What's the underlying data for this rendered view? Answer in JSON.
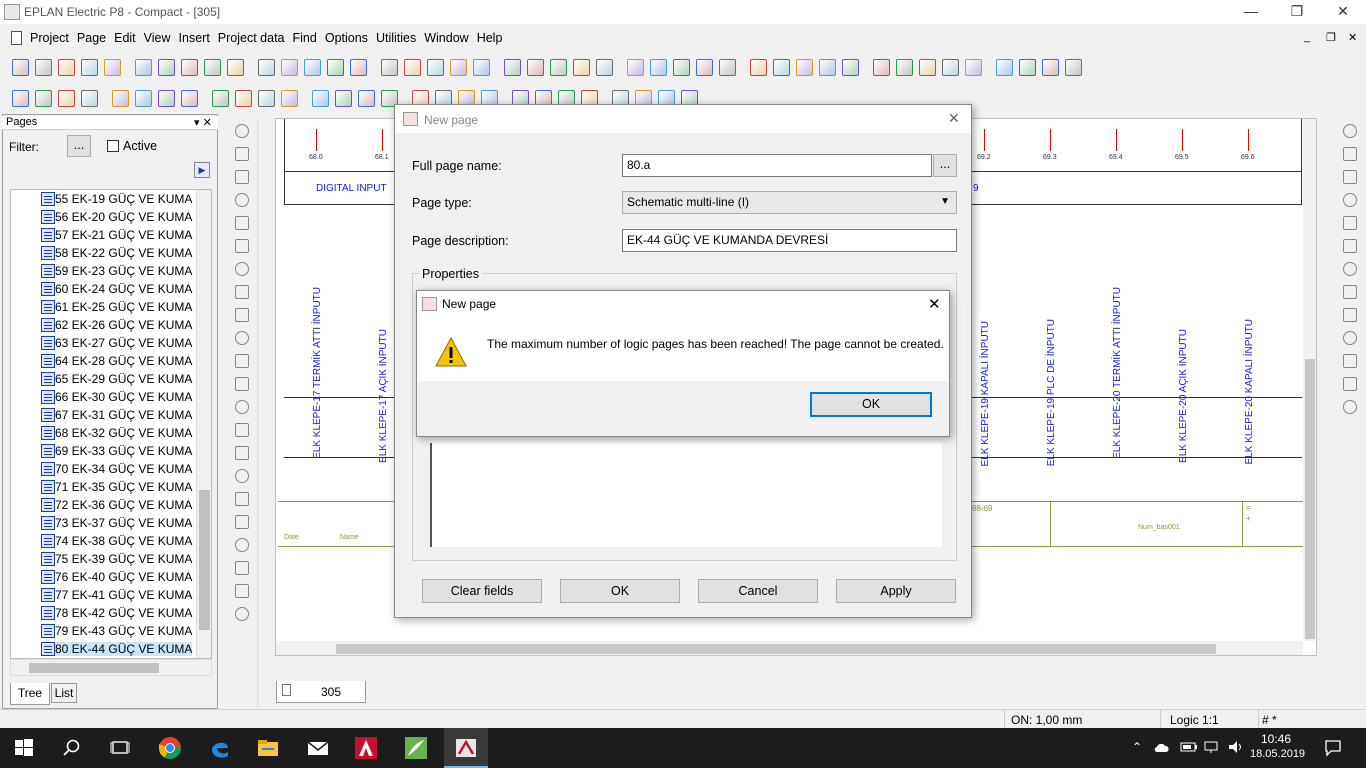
{
  "window": {
    "title": "EPLAN Electric P8 - Compact - [305]",
    "btn_minimize": "—",
    "btn_restore": "❐",
    "btn_close": "✕"
  },
  "menu": [
    "Project",
    "Page",
    "Edit",
    "View",
    "Insert",
    "Project data",
    "Find",
    "Options",
    "Utilities",
    "Window",
    "Help"
  ],
  "mdi_controls": {
    "minimize": "_",
    "restore": "❐",
    "close": "✕"
  },
  "pages_panel": {
    "title": "Pages",
    "pin": "▾ ✕",
    "filter_label": "Filter:",
    "filter_button": "...",
    "active_label": "Active",
    "items": [
      "55 EK-19 GÜÇ VE KUMA",
      "56 EK-20 GÜÇ VE KUMA",
      "57 EK-21 GÜÇ VE KUMA",
      "58 EK-22 GÜÇ VE KUMA",
      "59 EK-23 GÜÇ VE KUMA",
      "60 EK-24 GÜÇ VE KUMA",
      "61 EK-25 GÜÇ VE KUMA",
      "62 EK-26 GÜÇ VE KUMA",
      "63 EK-27 GÜÇ VE KUMA",
      "64 EK-28 GÜÇ VE KUMA",
      "65 EK-29 GÜÇ VE KUMA",
      "66 EK-30 GÜÇ VE KUMA",
      "67 EK-31 GÜÇ VE KUMA",
      "68 EK-32 GÜÇ VE KUMA",
      "69 EK-33 GÜÇ VE KUMA",
      "70 EK-34 GÜÇ VE KUMA",
      "71 EK-35 GÜÇ VE KUMA",
      "72 EK-36 GÜÇ VE KUMA",
      "73 EK-37 GÜÇ VE KUMA",
      "74 EK-38 GÜÇ VE KUMA",
      "75 EK-39 GÜÇ VE KUMA",
      "76 EK-40 GÜÇ VE KUMA",
      "77 EK-41 GÜÇ VE KUMA",
      "78 EK-42 GÜÇ VE KUMA",
      "79 EK-43 GÜÇ VE KUMA",
      "80 EK-44 GÜÇ VE KUMA"
    ],
    "tab_tree": "Tree",
    "tab_list": "List"
  },
  "drawing": {
    "pin_labels": [
      "68.0",
      "68.1",
      "69.2",
      "69.3",
      "69.4",
      "69.5",
      "69.6"
    ],
    "header_text": "DIGITAL INPUT",
    "header_text_right": "9",
    "vertical_texts_left": [
      "ELK KLEPE-17  TERMİK ATTI İNPUTU",
      "ELK KLEPE-17 AÇIK İNPUTU"
    ],
    "vertical_texts_right": [
      "ELK KLEPE-19 KAPALI İNPUTU",
      "ELK KLEPE-19 PLC DE İNPUTU",
      "ELK KLEPE-20  TERMİK ATTI İNPUTU",
      "ELK KLEPE-20 AÇIK İNPUTU",
      "ELK KLEPE-20 KAPALI İNPUTU"
    ],
    "titleblock": {
      "date": "Date",
      "name": "Name",
      "range": "68-69",
      "num": "Num_bas001",
      "eq": "=",
      "plus": "+"
    },
    "page_tab": "305"
  },
  "new_page_dialog": {
    "title": "New page",
    "full_page_name_label": "Full page name:",
    "full_page_name_value": "80.a",
    "browse": "...",
    "page_type_label": "Page type:",
    "page_type_value": "Schematic multi-line (I)",
    "page_description_label": "Page description:",
    "page_description_value": "EK-44 GÜÇ VE KUMANDA DEVRESİ",
    "properties_label": "Properties",
    "btn_clear": "Clear fields",
    "btn_ok": "OK",
    "btn_cancel": "Cancel",
    "btn_apply": "Apply"
  },
  "alert_dialog": {
    "title": "New page",
    "message": "The maximum number of logic pages has been reached! The page cannot be created.",
    "btn_ok": "OK"
  },
  "statusbar": {
    "grid": "ON: 1,00 mm",
    "mode": "Logic 1:1",
    "hash": "# *"
  },
  "taskbar": {
    "time": "10:46",
    "date": "18.05.2019"
  }
}
